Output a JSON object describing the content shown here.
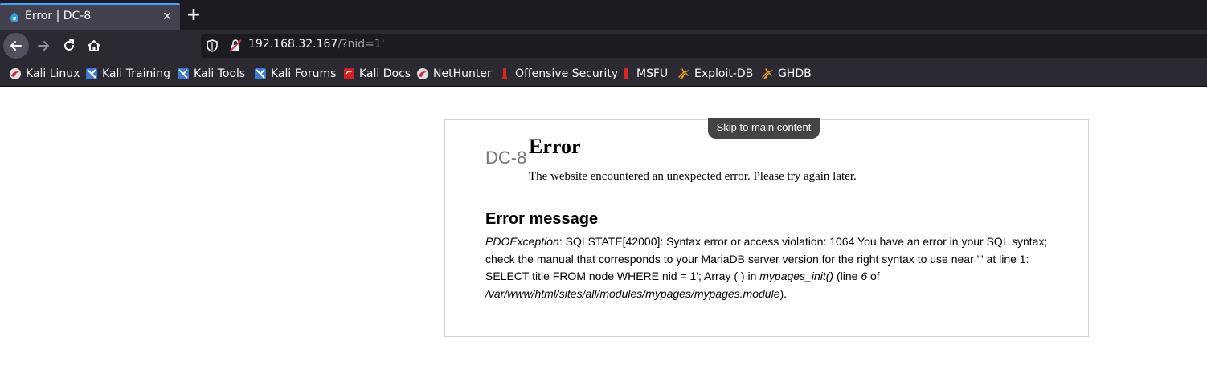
{
  "tab": {
    "title": "Error | DC-8"
  },
  "address_bar": {
    "host": "192.168.32.167",
    "path": "/?nid=1'"
  },
  "bookmarks": [
    {
      "label": "Kali Linux",
      "icon": "kali-dragon-icon"
    },
    {
      "label": "Kali Training",
      "icon": "kali-training-icon"
    },
    {
      "label": "Kali Tools",
      "icon": "kali-tools-icon"
    },
    {
      "label": "Kali Forums",
      "icon": "kali-forums-icon"
    },
    {
      "label": "Kali Docs",
      "icon": "kali-docs-icon"
    },
    {
      "label": "NetHunter",
      "icon": "nethunter-icon"
    },
    {
      "label": "Offensive Security",
      "icon": "offsec-icon"
    },
    {
      "label": "MSFU",
      "icon": "msfu-icon"
    },
    {
      "label": "Exploit-DB",
      "icon": "exploit-db-icon"
    },
    {
      "label": "GHDB",
      "icon": "ghdb-icon"
    }
  ],
  "page": {
    "skip_link": "Skip to main content",
    "site_name": "DC-8",
    "title": "Error",
    "description": "The website encountered an unexpected error. Please try again later.",
    "error_heading": "Error message",
    "error": {
      "exception": "PDOException",
      "message": ": SQLSTATE[42000]: Syntax error or access violation: 1064 You have an error in your SQL syntax; check the manual that corresponds to your MariaDB server version for the right syntax to use near ''' at line 1: SELECT title FROM node WHERE nid = 1'; Array ( ) in ",
      "function": "mypages_init()",
      "line_prefix": " (line ",
      "line": "6",
      "of_text": " of ",
      "file": "/var/www/html/sites/all/modules/mypages/mypages.module",
      "suffix": ")."
    }
  },
  "colors": {
    "tab_accent": "#45a1ff",
    "chrome_dark": "#1c1b22",
    "chrome": "#2b2a33",
    "skip_link_bg": "#444444"
  }
}
